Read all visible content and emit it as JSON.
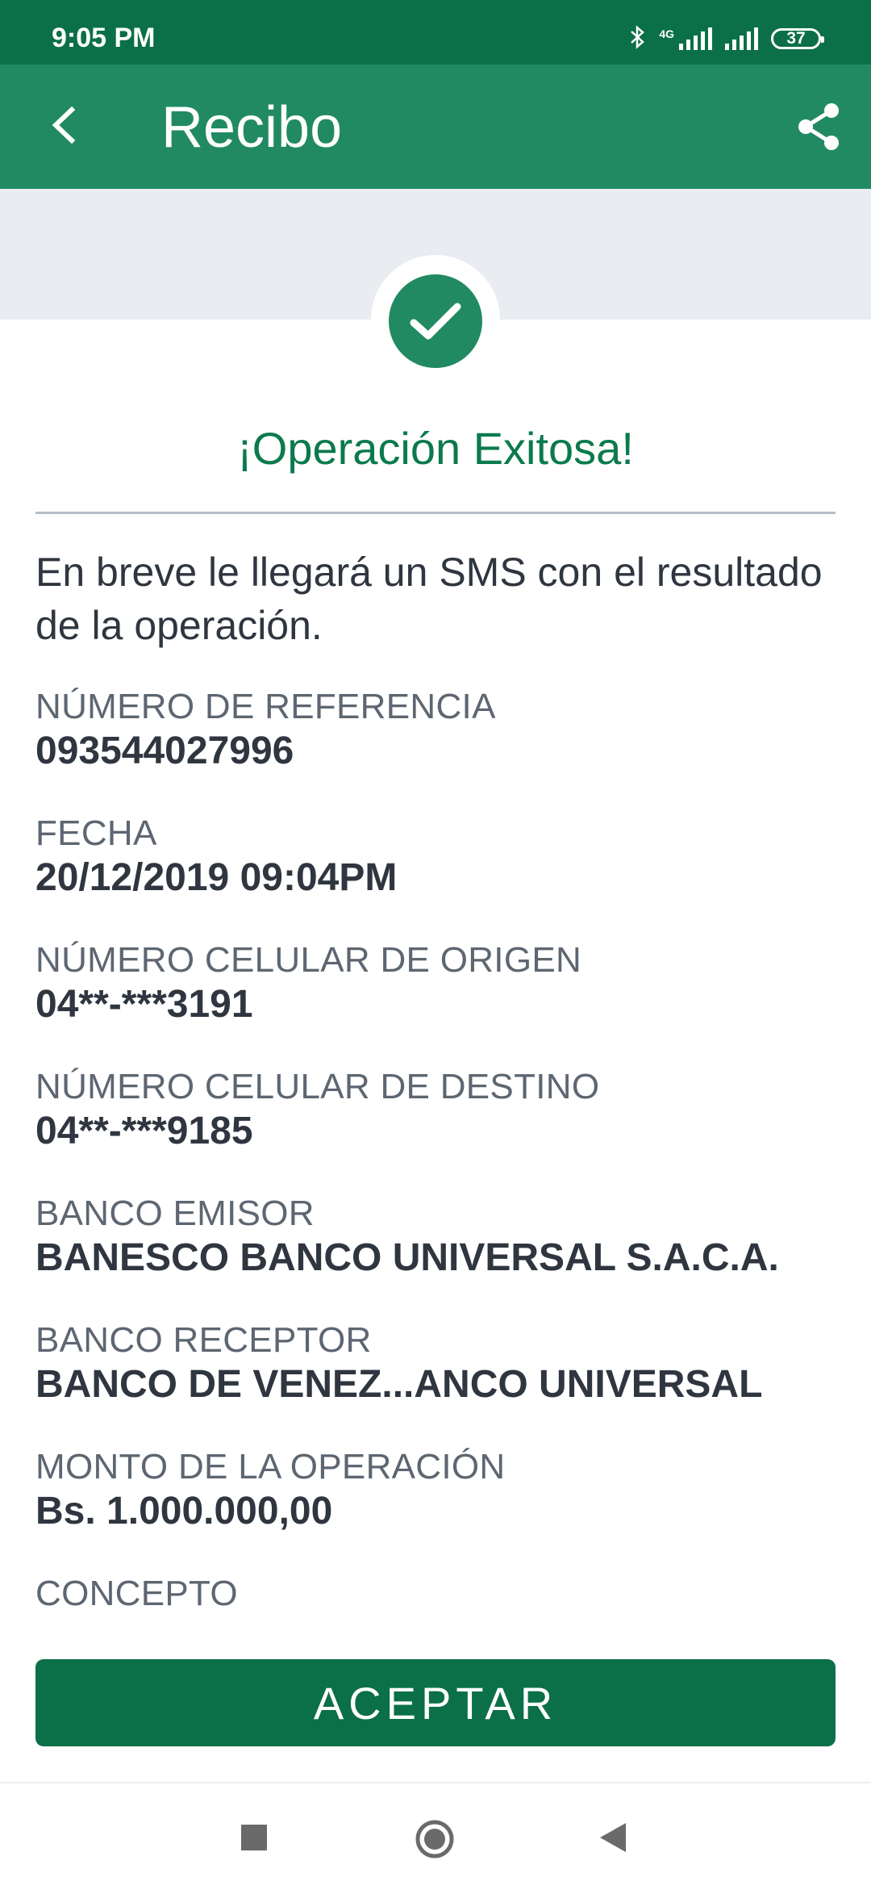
{
  "status_bar": {
    "time": "9:05 PM",
    "network": "4G",
    "battery": "37",
    "icons": [
      "bluetooth-icon",
      "signal-icon",
      "signal-icon",
      "battery-icon"
    ]
  },
  "app_bar": {
    "title": "Recibo",
    "icons": [
      "back-arrow-icon",
      "share-icon"
    ]
  },
  "success": {
    "icon": "checkmark-icon",
    "title": "¡Operación Exitosa!"
  },
  "message": "En breve le llegará un SMS con el resultado de la operación.",
  "fields": [
    {
      "label": "NÚMERO DE REFERENCIA",
      "value": "093544027996"
    },
    {
      "label": "FECHA",
      "value": "20/12/2019 09:04PM"
    },
    {
      "label": "NÚMERO CELULAR DE ORIGEN",
      "value": "04**-***3191"
    },
    {
      "label": "NÚMERO CELULAR DE DESTINO",
      "value": "04**-***9185"
    },
    {
      "label": "BANCO EMISOR",
      "value": "BANESCO BANCO UNIVERSAL S.A.C.A."
    },
    {
      "label": "BANCO RECEPTOR",
      "value": "BANCO DE VENEZ...ANCO UNIVERSAL"
    },
    {
      "label": "MONTO DE LA OPERACIÓN",
      "value": "Bs. 1.000.000,00"
    },
    {
      "label": "CONCEPTO",
      "value": ""
    }
  ],
  "accept_button": "ACEPTAR",
  "nav_bar": {
    "icons": [
      "recents-icon",
      "home-icon",
      "back-icon"
    ]
  },
  "colors": {
    "status_bar": "#0b6f48",
    "app_bar": "#218a63",
    "accent_text": "#0b7a4d",
    "button": "#0b6f48"
  }
}
